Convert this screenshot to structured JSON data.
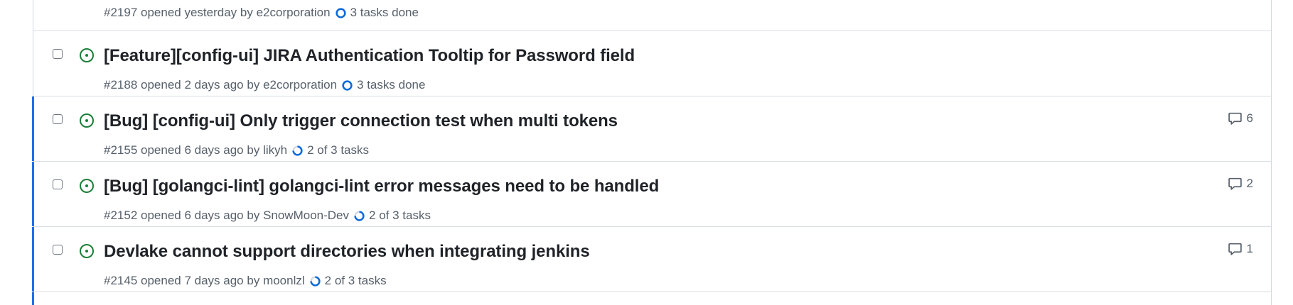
{
  "issues": [
    {
      "number": "#2197",
      "opened": "opened yesterday by",
      "author": "e2corporation",
      "task_label": "3 tasks done",
      "task_state": "done",
      "title": "",
      "comments": ""
    },
    {
      "number": "#2188",
      "opened": "opened 2 days ago by",
      "author": "e2corporation",
      "task_label": "3 tasks done",
      "task_state": "done",
      "title": "[Feature][config-ui] JIRA Authentication Tooltip for Password field",
      "comments": ""
    },
    {
      "number": "#2155",
      "opened": "opened 6 days ago by",
      "author": "likyh",
      "task_label": "2 of 3 tasks",
      "task_state": "partial",
      "title": "[Bug] [config-ui] Only trigger connection test when multi tokens",
      "comments": "6"
    },
    {
      "number": "#2152",
      "opened": "opened 6 days ago by",
      "author": "SnowMoon-Dev",
      "task_label": "2 of 3 tasks",
      "task_state": "partial",
      "title": "[Bug] [golangci-lint] golangci-lint error messages need to be handled",
      "comments": "2"
    },
    {
      "number": "#2145",
      "opened": "opened 7 days ago by",
      "author": "moonlzl",
      "task_label": "2 of 3 tasks",
      "task_state": "partial",
      "title": "Devlake cannot support directories when integrating jenkins",
      "comments": "1"
    }
  ],
  "icons": {
    "open_issue": "issue-opened-icon",
    "comment": "comment-icon",
    "task_done": "task-done-icon",
    "task_partial": "task-progress-icon"
  },
  "colors": {
    "open_green": "#1a7f37",
    "task_blue": "#0969da",
    "highlight_border": "#1f6feb"
  }
}
